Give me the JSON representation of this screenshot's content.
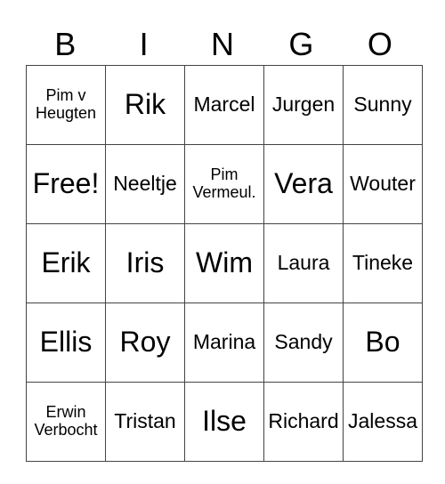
{
  "header": [
    "B",
    "I",
    "N",
    "G",
    "O"
  ],
  "rows": [
    [
      {
        "text": "Pim v Heugten",
        "size": "s18",
        "lines": [
          "Pim v",
          "Heugten"
        ]
      },
      {
        "text": "Rik",
        "size": "s32"
      },
      {
        "text": "Marcel",
        "size": "s22"
      },
      {
        "text": "Jurgen",
        "size": "s22"
      },
      {
        "text": "Sunny",
        "size": "s22"
      }
    ],
    [
      {
        "text": "Free!",
        "size": "s32"
      },
      {
        "text": "Neeltje",
        "size": "s22"
      },
      {
        "text": "Pim Vermeul.",
        "size": "s18",
        "lines": [
          "Pim",
          "Vermeul."
        ]
      },
      {
        "text": "Vera",
        "size": "s32"
      },
      {
        "text": "Wouter",
        "size": "s22"
      }
    ],
    [
      {
        "text": "Erik",
        "size": "s32"
      },
      {
        "text": "Iris",
        "size": "s32"
      },
      {
        "text": "Wim",
        "size": "s32"
      },
      {
        "text": "Laura",
        "size": "s22"
      },
      {
        "text": "Tineke",
        "size": "s22"
      }
    ],
    [
      {
        "text": "Ellis",
        "size": "s32"
      },
      {
        "text": "Roy",
        "size": "s32"
      },
      {
        "text": "Marina",
        "size": "s22"
      },
      {
        "text": "Sandy",
        "size": "s22"
      },
      {
        "text": "Bo",
        "size": "s32"
      }
    ],
    [
      {
        "text": "Erwin Verbocht",
        "size": "s18",
        "lines": [
          "Erwin",
          "Verbocht"
        ]
      },
      {
        "text": "Tristan",
        "size": "s22"
      },
      {
        "text": "Ilse",
        "size": "s32"
      },
      {
        "text": "Richard",
        "size": "s22"
      },
      {
        "text": "Jalessa",
        "size": "s22"
      }
    ]
  ]
}
